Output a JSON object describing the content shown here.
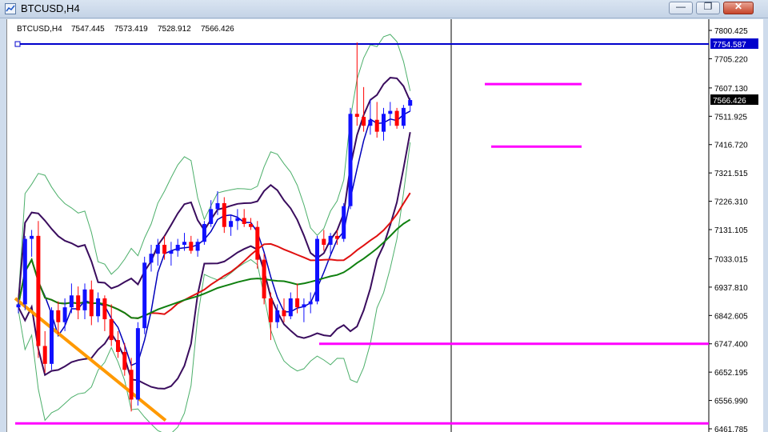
{
  "window": {
    "title": "BTCUSD,H4",
    "min_glyph": "—",
    "max_glyph": "❐",
    "close_glyph": "✕"
  },
  "chart": {
    "info": {
      "symbol": "BTCUSD,H4",
      "open": "7547.445",
      "high": "7573.419",
      "low": "7528.912",
      "close": "7566.426"
    },
    "price_labels": [
      "7800.425",
      "7705.220",
      "7607.130",
      "7511.925",
      "7416.720",
      "7321.515",
      "7226.310",
      "7131.105",
      "7033.015",
      "6937.810",
      "6842.605",
      "6747.400",
      "6652.195",
      "6556.990",
      "6461.785"
    ],
    "hline_badge": "7754.587",
    "price_badge": "7566.426",
    "colors": {
      "bull": "#1010ff",
      "bear": "#ff0000",
      "hline_blue": "#0000cc",
      "magenta": "#ff00ff",
      "trend_orange": "#ff9900",
      "ma_red": "#e01010",
      "ma_green": "#108010",
      "band_purple": "#3a0d5e",
      "band_blue": "#0000bb",
      "band_green": "#4caf6a"
    }
  },
  "chart_data": {
    "type": "candlestick",
    "title": "BTCUSD,H4",
    "ylim": [
      6461.785,
      7800.425
    ],
    "yticks": [
      7800.425,
      7705.22,
      7607.13,
      7511.925,
      7416.72,
      7321.515,
      7226.31,
      7131.105,
      7033.015,
      6937.81,
      6842.605,
      6747.4,
      6652.195,
      6556.99,
      6461.785
    ],
    "horizontal_lines": [
      {
        "value": 7754.587,
        "color": "blue"
      },
      {
        "value": 6747.4,
        "color": "magenta"
      },
      {
        "value": 6480,
        "color": "magenta"
      }
    ],
    "last_price": 7566.426,
    "candles": [
      [
        6870,
        6900,
        6850,
        6880
      ],
      [
        6880,
        7110,
        6860,
        7100
      ],
      [
        7100,
        7130,
        7040,
        7110
      ],
      [
        7110,
        7160,
        6700,
        6740
      ],
      [
        6740,
        6790,
        6650,
        6680
      ],
      [
        6680,
        6870,
        6660,
        6860
      ],
      [
        6860,
        6890,
        6780,
        6820
      ],
      [
        6820,
        6900,
        6790,
        6870
      ],
      [
        6870,
        6950,
        6850,
        6910
      ],
      [
        6910,
        6940,
        6830,
        6860
      ],
      [
        6860,
        6950,
        6830,
        6930
      ],
      [
        6930,
        6960,
        6810,
        6840
      ],
      [
        6840,
        6920,
        6820,
        6900
      ],
      [
        6900,
        6910,
        6790,
        6830
      ],
      [
        6830,
        6880,
        6740,
        6760
      ],
      [
        6760,
        6790,
        6700,
        6720
      ],
      [
        6720,
        6750,
        6640,
        6660
      ],
      [
        6660,
        6700,
        6520,
        6560
      ],
      [
        6560,
        6820,
        6540,
        6800
      ],
      [
        6800,
        7040,
        6780,
        7020
      ],
      [
        7020,
        7080,
        6990,
        7050
      ],
      [
        7050,
        7100,
        7010,
        7080
      ],
      [
        7080,
        7110,
        7030,
        7050
      ],
      [
        7050,
        7090,
        7010,
        7060
      ],
      [
        7060,
        7100,
        7040,
        7080
      ],
      [
        7080,
        7120,
        7060,
        7090
      ],
      [
        7090,
        7110,
        7050,
        7060
      ],
      [
        7060,
        7100,
        7040,
        7090
      ],
      [
        7090,
        7160,
        7080,
        7150
      ],
      [
        7150,
        7230,
        7140,
        7200
      ],
      [
        7200,
        7260,
        7180,
        7220
      ],
      [
        7220,
        7240,
        7120,
        7140
      ],
      [
        7140,
        7180,
        7110,
        7160
      ],
      [
        7160,
        7200,
        7130,
        7170
      ],
      [
        7170,
        7200,
        7140,
        7150
      ],
      [
        7150,
        7170,
        7130,
        7140
      ],
      [
        7140,
        7160,
        7000,
        7030
      ],
      [
        7030,
        7050,
        6880,
        6900
      ],
      [
        6900,
        6920,
        6760,
        6820
      ],
      [
        6820,
        6880,
        6800,
        6860
      ],
      [
        6860,
        6900,
        6820,
        6840
      ],
      [
        6840,
        6920,
        6830,
        6900
      ],
      [
        6900,
        6950,
        6850,
        6870
      ],
      [
        6870,
        6900,
        6820,
        6880
      ],
      [
        6880,
        6920,
        6850,
        6890
      ],
      [
        6890,
        7110,
        6880,
        7100
      ],
      [
        7100,
        7130,
        7060,
        7080
      ],
      [
        7080,
        7120,
        7050,
        7110
      ],
      [
        7110,
        7130,
        7080,
        7100
      ],
      [
        7100,
        7220,
        7090,
        7210
      ],
      [
        7210,
        7540,
        7200,
        7520
      ],
      [
        7520,
        7760,
        7480,
        7510
      ],
      [
        7510,
        7610,
        7460,
        7480
      ],
      [
        7480,
        7570,
        7450,
        7500
      ],
      [
        7500,
        7560,
        7440,
        7460
      ],
      [
        7460,
        7540,
        7430,
        7520
      ],
      [
        7520,
        7560,
        7480,
        7530
      ],
      [
        7530,
        7540,
        7470,
        7480
      ],
      [
        7480,
        7550,
        7470,
        7540
      ],
      [
        7547.445,
        7573.419,
        7528.912,
        7566.426
      ]
    ]
  }
}
